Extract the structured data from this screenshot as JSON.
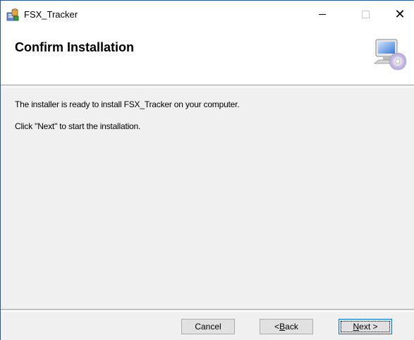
{
  "window": {
    "title": "FSX_Tracker",
    "minimize_glyph": "",
    "close_glyph": "✕"
  },
  "banner": {
    "title": "Confirm Installation",
    "icon": "computer-cd-icon"
  },
  "content": {
    "line1": "The installer is ready to install FSX_Tracker on your computer.",
    "line2": "Click \"Next\" to start the installation."
  },
  "buttons": {
    "cancel": "Cancel",
    "back_prefix": "< ",
    "back_mnemonic": "B",
    "back_rest": "ack",
    "next_mnemonic": "N",
    "next_rest": "ext >"
  },
  "colors": {
    "accent": "#0078d7",
    "border": "#2b5797",
    "background": "#f0f0f0"
  }
}
